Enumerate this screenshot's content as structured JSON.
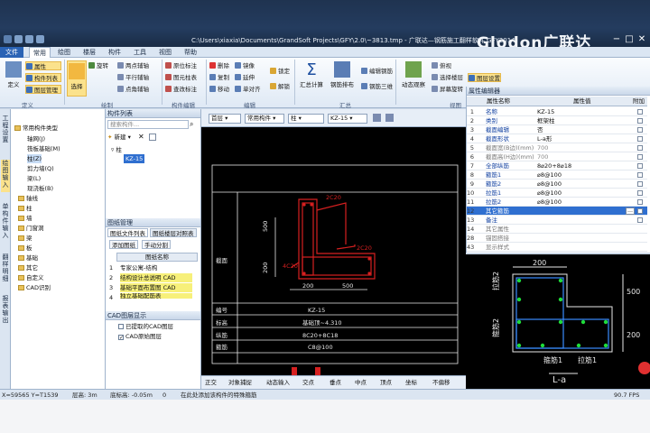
{
  "window": {
    "title": "C:\\Users\\xiaxia\\Documents\\GrandSoft Projects\\GFY\\2.0\\~3813.tmp - 广联达—钢筋施工翻样软件 GFY2014",
    "brand": "Glodon广联达",
    "controls": [
      "−",
      "□",
      "✕"
    ]
  },
  "menu": {
    "file": "文件",
    "tabs": [
      "常用",
      "绘图",
      "楼层",
      "构件",
      "工具",
      "视图",
      "帮助"
    ],
    "active": "常用"
  },
  "ribbon": {
    "define": {
      "items": [
        "属性",
        "构件列表",
        "图层管理"
      ],
      "big": "定义",
      "group": "定义"
    },
    "draw": {
      "big_select": "选择",
      "big_rotate": "旋转",
      "items": [
        "两点辅轴",
        "平行辅轴",
        "点角辅轴"
      ],
      "group": "绘制"
    },
    "edit_component": {
      "items": [
        "原位标注",
        "图元柱表",
        "查改标注"
      ],
      "group": "构件编辑"
    },
    "edit": {
      "items": [
        "删除",
        "镜像",
        "复制",
        "延伸",
        "移动",
        "单对齐"
      ],
      "lock": "锁定",
      "unlock": "解锁",
      "group": "编辑"
    },
    "summary": {
      "calc": "汇总计算",
      "rebar_layout": "钢筋排布",
      "rebar_3d": "钢筋三维",
      "rebar_edit": "编辑钢筋",
      "group": "汇总"
    },
    "view": {
      "observe": "动态观察",
      "select_floor": "选择楼层",
      "screen_rotate": "屏幕旋转",
      "perspective": "俯视",
      "layer": "图层设置",
      "group": "视图"
    }
  },
  "side_tabs": [
    "工程设置",
    "绘图输入",
    "单构件输入",
    "翻样明细",
    "报表输出"
  ],
  "nav_tree": {
    "root": "常用构件类型",
    "items": [
      "轴网(J)",
      "筏板基础(M)",
      "柱(Z)",
      "剪力墙(Q)",
      "梁(L)",
      "现浇板(B)",
      "轴线",
      "柱",
      "墙",
      "门窗洞",
      "梁",
      "板",
      "基础",
      "其它",
      "自定义",
      "CAD识别"
    ]
  },
  "component_list": {
    "title": "构件列表",
    "search_placeholder": "搜索构件...",
    "new_label": "新建",
    "root": "柱",
    "selected": "KZ-15"
  },
  "drawing_manager": {
    "title": "图纸管理",
    "tabs": [
      "图纸文件列表",
      "图纸楼层对照表"
    ],
    "add_label": "添加图纸",
    "split_label": "手动分割",
    "col_header": "图纸名称",
    "rows": [
      {
        "num": "1",
        "name": "专家公寓-结构"
      },
      {
        "num": "2",
        "name": "结构设计总说明 CAD"
      },
      {
        "num": "3",
        "name": "基础平面布置图 CAD"
      },
      {
        "num": "4",
        "name": "独立基础配筋表"
      }
    ]
  },
  "cad_layer": {
    "title": "CAD图层显示",
    "items": [
      "已提取的CAD图层",
      "CAD原始图层"
    ]
  },
  "drawing_toolbar": {
    "floor": "首层",
    "category": "常用构件",
    "type": "柱",
    "component": "KZ-15"
  },
  "drawing": {
    "section_label": "截面",
    "dim_top": "2C20",
    "dim_mid": "2C20",
    "dim_left": "4C20",
    "dim_500_v": "500",
    "dim_200_v": "200",
    "dim_200_h": "200",
    "dim_500_h": "500",
    "rows": [
      {
        "label": "编号",
        "value": "KZ-15"
      },
      {
        "label": "标高",
        "value": "基础顶~4.310"
      },
      {
        "label": "纵筋",
        "value": "8C20+8C18"
      },
      {
        "label": "箍筋",
        "value": "C8@100"
      }
    ]
  },
  "snap_bar": [
    "正交",
    "对象捕捉",
    "动态输入",
    "交点",
    "垂点",
    "中点",
    "顶点",
    "坐标",
    "不偏移"
  ],
  "property_editor": {
    "title": "属性编辑器",
    "headers": {
      "name": "属性名称",
      "value": "属性值",
      "extra": "附加"
    },
    "rows": [
      {
        "num": "1",
        "name": "名称",
        "value": "KZ-15"
      },
      {
        "num": "2",
        "name": "类别",
        "value": "框架柱"
      },
      {
        "num": "3",
        "name": "截面编辑",
        "value": "否"
      },
      {
        "num": "4",
        "name": "截面形状",
        "value": "L-a形"
      },
      {
        "num": "5",
        "name": "截面宽(B边)(mm)",
        "value": "700"
      },
      {
        "num": "6",
        "name": "截面高(H边)(mm)",
        "value": "700"
      },
      {
        "num": "7",
        "name": "全部纵筋",
        "value": "8⌀20+8⌀18"
      },
      {
        "num": "8",
        "name": "箍筋1",
        "value": "⌀8@100"
      },
      {
        "num": "9",
        "name": "箍筋2",
        "value": "⌀8@100"
      },
      {
        "num": "10",
        "name": "拉筋1",
        "value": "⌀8@100"
      },
      {
        "num": "11",
        "name": "拉筋2",
        "value": "⌀8@100"
      },
      {
        "num": "12",
        "name": "其它箍筋",
        "value": ""
      },
      {
        "num": "13",
        "name": "备注",
        "value": ""
      },
      {
        "num": "14",
        "name": "其它属性",
        "value": ""
      },
      {
        "num": "28",
        "name": "锚固搭接",
        "value": ""
      },
      {
        "num": "43",
        "name": "显示样式",
        "value": ""
      }
    ]
  },
  "preview": {
    "dim_200": "200",
    "dim_500_r": "500",
    "dim_200_r": "200",
    "lbl_lajin2": "拉筋2",
    "lbl_gujin2": "箍筋2",
    "lbl_gujin1": "箍筋1",
    "lbl_lajin1": "拉筋1",
    "shape_name": "L-a"
  },
  "status_bar": {
    "coords": "X=59565 Y=T1539",
    "floor_height": "层高: 3m",
    "base_elev": "底标高: -0.05m",
    "count": "0",
    "hint": "在此处添加该构件的特殊箍筋",
    "fps": "90.7 FPS"
  },
  "colors": {
    "title_bg": "#1f3350",
    "ribbon_bg": "#dfe9f5",
    "highlight": "#fbe28c",
    "cad_red": "#d62020",
    "cad_white": "#e8e8e8",
    "preview_bar": "#1fdc3a"
  }
}
